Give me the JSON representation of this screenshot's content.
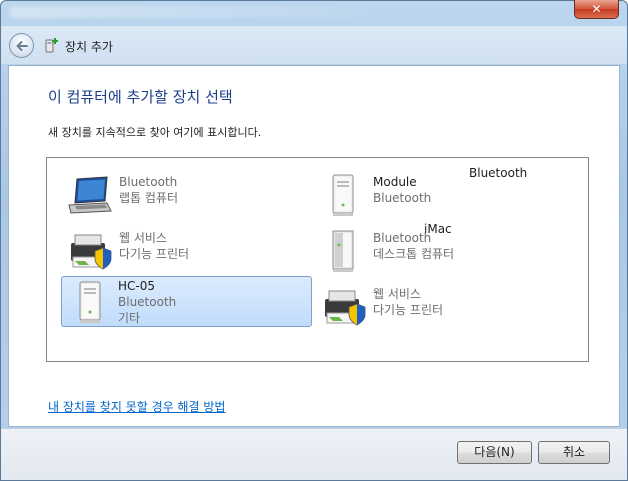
{
  "window": {
    "close_glyph": "✕",
    "title": "장치 추가"
  },
  "content": {
    "heading": "이 컴퓨터에 추가할 장치 선택",
    "subtext": "새 장치를 지속적으로 찾아 여기에 표시합니다."
  },
  "devices": [
    {
      "icon": "laptop-icon",
      "line1": "Bluetooth",
      "line2": "랩톱 컴퓨터",
      "selected": false,
      "dimmed": true
    },
    {
      "icon": "tower-pc-icon",
      "line1": "Module",
      "line2": "Bluetooth",
      "selected": false,
      "dimmed": false
    },
    {
      "icon": "printer-icon",
      "line1": "웹 서비스",
      "line2": "다기능 프린터",
      "selected": false,
      "dimmed": true
    },
    {
      "icon": "imac-icon",
      "line1": "Bluetooth",
      "line2": "데스크톱 컴퓨터",
      "selected": false,
      "dimmed": false
    },
    {
      "icon": "tower-pc-icon",
      "line1": "HC-05",
      "line2": "Bluetooth",
      "line3": "기타",
      "selected": true,
      "dimmed": false
    },
    {
      "icon": "printer-icon",
      "line1": "웹 서비스",
      "line2": "다기능 프린터",
      "selected": false,
      "dimmed": true
    }
  ],
  "floating_labels": {
    "bluetooth": "Bluetooth",
    "imac": "iMac"
  },
  "help_link": "내 장치를 찾지 못할 경우 해결 방법",
  "buttons": {
    "next": "다음(N)",
    "cancel": "취소"
  }
}
